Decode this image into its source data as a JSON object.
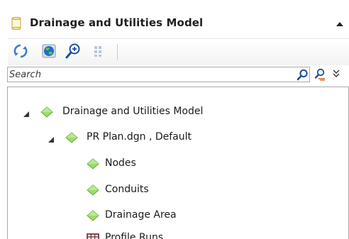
{
  "header": {
    "title": "Drainage and Utilities Model",
    "panel_icon": "document-cylinder-icon",
    "collapse_icon": "caret-up-icon"
  },
  "toolbar": {
    "buttons": [
      {
        "name": "refresh-icon"
      },
      {
        "name": "globe-icon"
      },
      {
        "name": "zoom-in-icon"
      },
      {
        "name": "grid-icon"
      }
    ]
  },
  "search": {
    "placeholder": "Search",
    "value": ""
  },
  "tree": {
    "root": {
      "label": "Drainage and Utilities Model",
      "expanded": true
    },
    "model": {
      "label": "PR Plan.dgn , Default",
      "expanded": true
    },
    "items": [
      {
        "label": "Nodes",
        "icon": "green-diamond-icon"
      },
      {
        "label": "Conduits",
        "icon": "green-diamond-icon"
      },
      {
        "label": "Drainage Area",
        "icon": "green-diamond-icon"
      },
      {
        "label": "Profile Runs",
        "icon": "table-grid-icon"
      }
    ]
  },
  "colors": {
    "diamond_fill": "#9fdc6a",
    "diamond_stroke": "#5aa63a",
    "border": "#a9a9a9",
    "table_icon": "#6b1e2b"
  }
}
